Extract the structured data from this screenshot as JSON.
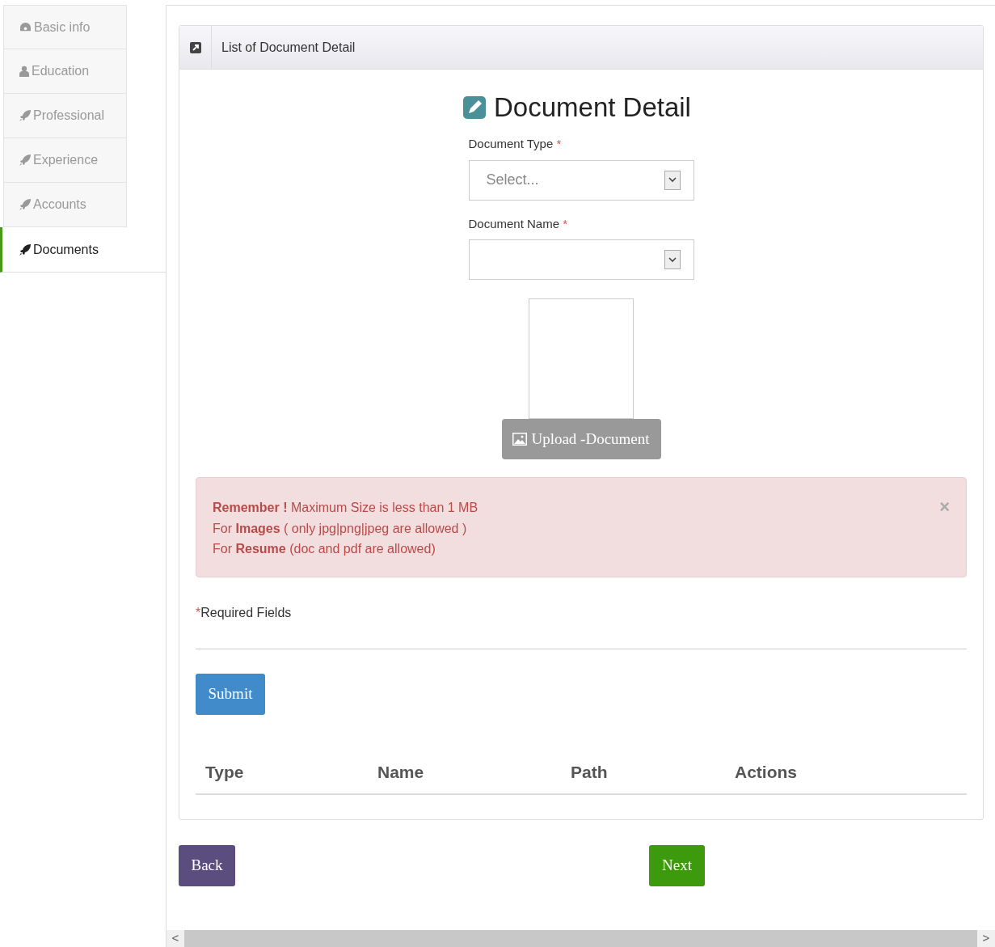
{
  "sidebar": {
    "items": [
      {
        "label": "Basic info",
        "kind": "dashboard",
        "selected": false
      },
      {
        "label": "Education",
        "kind": "user",
        "selected": false
      },
      {
        "label": "Professional",
        "kind": "rocket",
        "selected": false
      },
      {
        "label": "Experience",
        "kind": "rocket",
        "selected": false
      },
      {
        "label": "Accounts",
        "kind": "rocket",
        "selected": false
      },
      {
        "label": "Documents",
        "kind": "rocket",
        "selected": true
      }
    ]
  },
  "panel": {
    "title": "List of Document Detail",
    "heading": "Document Detail",
    "fields": [
      {
        "label": "Document Type",
        "required_mark": "*",
        "placeholder": "Select..."
      },
      {
        "label": "Document Name",
        "required_mark": "*"
      }
    ],
    "upload_button": "Upload -Document",
    "alert": {
      "lines": [
        "**Remember !** Maximum Size is less than 1 MB",
        "For **Images** ( only jpg|png|jpeg are allowed )",
        "For **Resume** (doc and pdf are allowed)"
      ],
      "close": "×"
    },
    "required_note": {
      "mark": "*",
      "text": "Required Fields"
    },
    "submit_button": "Submit",
    "table": {
      "columns": [
        "Type",
        "Name",
        "Path",
        "Actions"
      ]
    }
  },
  "back_button": "Back",
  "next_button": "Next",
  "scrollbar": {
    "left": "<",
    "right": ">"
  }
}
